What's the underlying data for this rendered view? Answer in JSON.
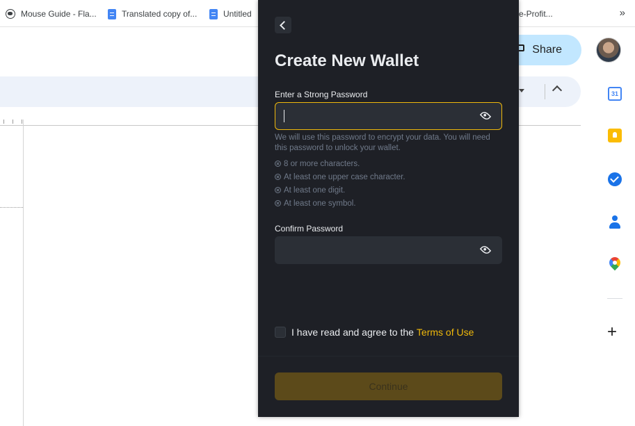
{
  "bookmarks": {
    "items": [
      {
        "label": "Mouse Guide - Fla...",
        "icon": "globe-icon"
      },
      {
        "label": "Translated copy of...",
        "icon": "doc-icon"
      },
      {
        "label": "Untitled",
        "icon": "doc-icon"
      },
      {
        "label": "e-Profit...",
        "icon": "none"
      }
    ],
    "more": "»"
  },
  "docs": {
    "share_label": "Share",
    "calendar_day": "31"
  },
  "wallet": {
    "title": "Create New Wallet",
    "password_label": "Enter a Strong Password",
    "password_value": "",
    "hint": "We will use this password to encrypt your data. You will need this password to unlock your wallet.",
    "rules": [
      "8 or more characters.",
      "At least one upper case character.",
      "At least one digit.",
      "At least one symbol."
    ],
    "confirm_label": "Confirm Password",
    "confirm_value": "",
    "agree_text": "I have read and agree to the",
    "terms_link": "Terms of Use",
    "continue_label": "Continue",
    "accent_color": "#f0b90b",
    "background_color": "#1e2026"
  }
}
